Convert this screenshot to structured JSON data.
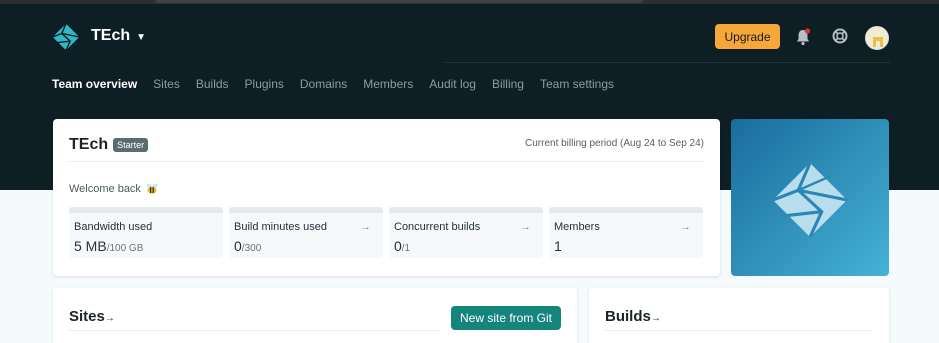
{
  "header": {
    "team_name": "TEch",
    "upgrade_label": "Upgrade",
    "nav": [
      {
        "label": "Team overview"
      },
      {
        "label": "Sites"
      },
      {
        "label": "Builds"
      },
      {
        "label": "Plugins"
      },
      {
        "label": "Domains"
      },
      {
        "label": "Members"
      },
      {
        "label": "Audit log"
      },
      {
        "label": "Billing"
      },
      {
        "label": "Team settings"
      }
    ]
  },
  "team_card": {
    "title": "TEch",
    "plan_badge": "Starter",
    "billing_period": "Current billing period (Aug 24 to Sep 24)",
    "welcome": "Welcome back",
    "stats": [
      {
        "label": "Bandwidth used",
        "value": "5 MB",
        "limit": "/100 GB",
        "arrow": ""
      },
      {
        "label": "Build minutes used",
        "value": "0",
        "limit": "/300",
        "arrow": "→"
      },
      {
        "label": "Concurrent builds",
        "value": "0",
        "limit": "/1",
        "arrow": "→"
      },
      {
        "label": "Members",
        "value": "1",
        "limit": "",
        "arrow": "→"
      }
    ]
  },
  "sites_card": {
    "title": "Sites",
    "arrow": "→",
    "new_site_label": "New site from Git"
  },
  "builds_card": {
    "title": "Builds",
    "arrow": "→"
  },
  "colors": {
    "header_bg": "#0e1e25",
    "accent_teal": "#15847d",
    "upgrade": "#f6a73a",
    "notification_dot": "#e2322d"
  },
  "icons": {
    "logo": "netlify-logo-icon",
    "bell": "bell-icon",
    "help": "lifebuoy-icon",
    "avatar": "avatar"
  }
}
